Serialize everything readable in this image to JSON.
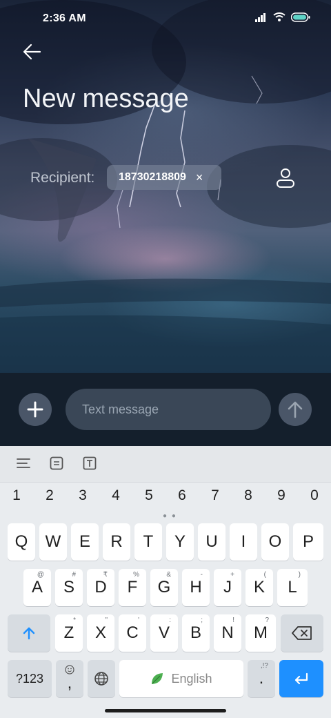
{
  "status_bar": {
    "time": "2:36 AM"
  },
  "header": {
    "title": "New message"
  },
  "recipient": {
    "label": "Recipient:",
    "chip": "18730218809",
    "remove": "×"
  },
  "compose": {
    "placeholder": "Text message"
  },
  "keyboard": {
    "numbers": [
      "1",
      "2",
      "3",
      "4",
      "5",
      "6",
      "7",
      "8",
      "9",
      "0"
    ],
    "row1": [
      "Q",
      "W",
      "E",
      "R",
      "T",
      "Y",
      "U",
      "I",
      "O",
      "P"
    ],
    "row2": [
      {
        "k": "A",
        "s": "@"
      },
      {
        "k": "S",
        "s": "#"
      },
      {
        "k": "D",
        "s": "₹"
      },
      {
        "k": "F",
        "s": "%"
      },
      {
        "k": "G",
        "s": "&"
      },
      {
        "k": "H",
        "s": "-"
      },
      {
        "k": "J",
        "s": "+"
      },
      {
        "k": "K",
        "s": "("
      },
      {
        "k": "L",
        "s": ")"
      }
    ],
    "row3": [
      {
        "k": "Z",
        "s": "*"
      },
      {
        "k": "X",
        "s": "\""
      },
      {
        "k": "C",
        "s": "'"
      },
      {
        "k": "V",
        "s": ":"
      },
      {
        "k": "B",
        "s": ";"
      },
      {
        "k": "N",
        "s": "!"
      },
      {
        "k": "M",
        "s": "?"
      }
    ],
    "symbols_label": "?123",
    "comma": ",",
    "space_label": "English",
    "period": ".",
    "period_sup": ",!?"
  },
  "colors": {
    "accent": "#1e90ff",
    "compose_bg": "#141f2c",
    "keyboard_bg": "#e9ecef"
  }
}
